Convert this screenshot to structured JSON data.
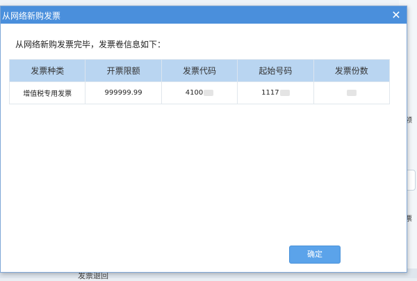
{
  "dialog": {
    "title": "从网络新购发票",
    "message": "从网络新购发票完毕，发票卷信息如下：",
    "close_label": "✕",
    "ok_label": "确定"
  },
  "table": {
    "headers": [
      "发票种类",
      "开票限额",
      "发票代码",
      "起始号码",
      "发票份数"
    ],
    "row": {
      "type": "增值税专用发票",
      "limit": "999999.99",
      "code": "4100",
      "start_number": "1117"
    }
  },
  "background": {
    "right_labels": [
      "领",
      "票"
    ],
    "bottom_label": "发票退回"
  }
}
